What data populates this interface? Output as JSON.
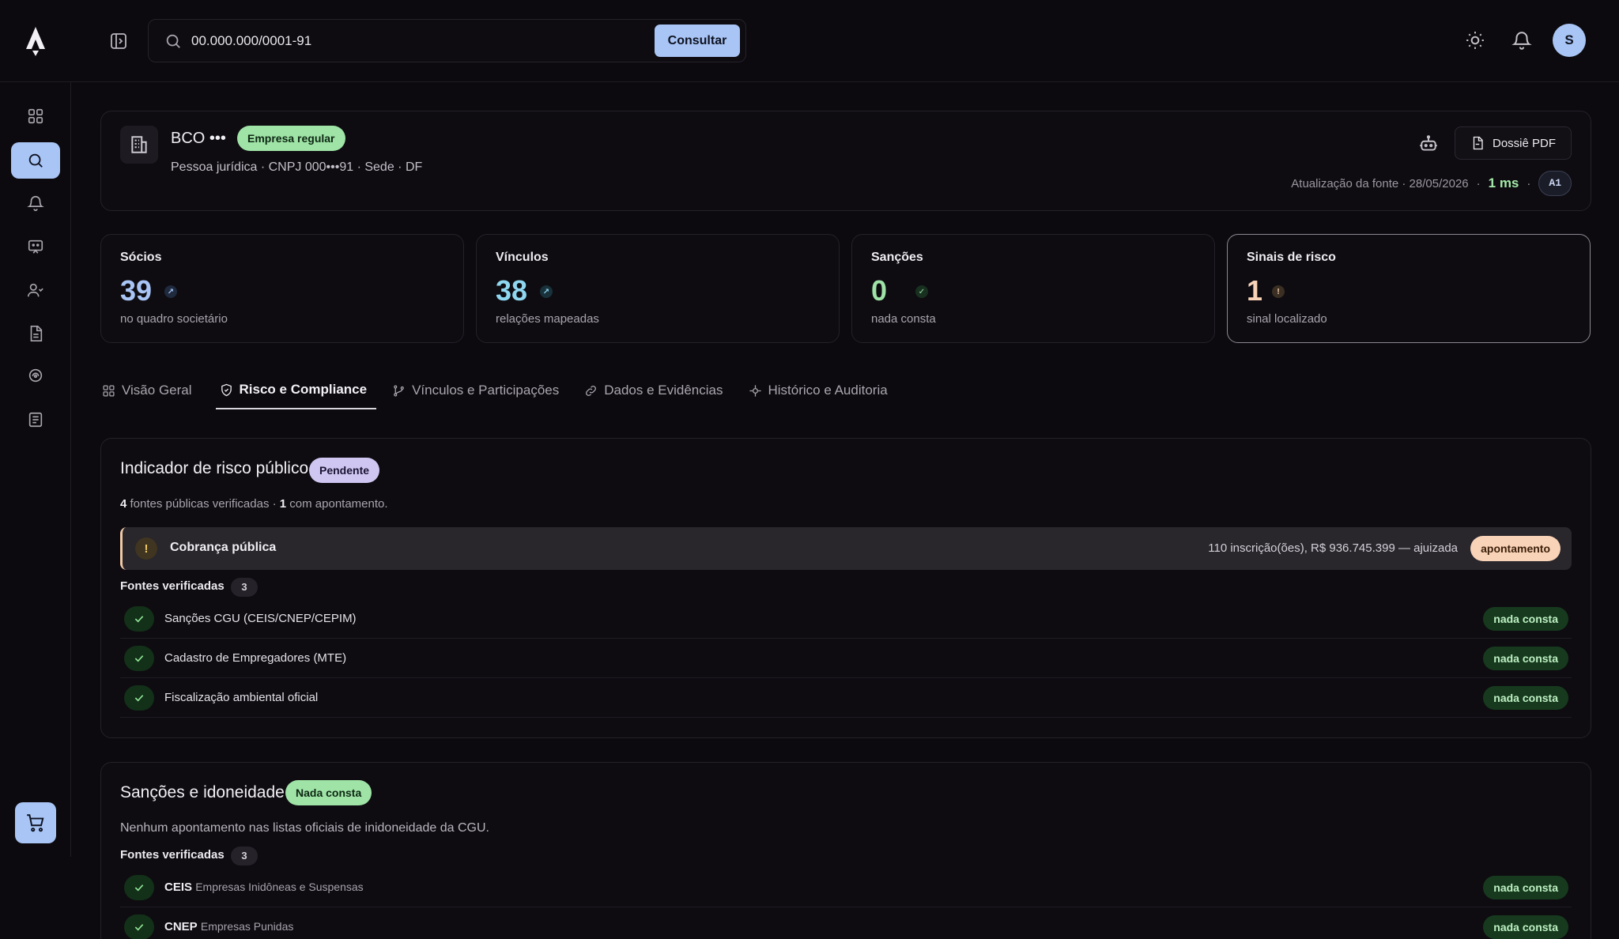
{
  "search": {
    "value": "00.000.000/0001-91",
    "button_label": "Consultar"
  },
  "user": {
    "initial": "S"
  },
  "sidebar": {
    "items": [
      {
        "icon": "grid-icon"
      },
      {
        "icon": "search-icon",
        "active": true
      },
      {
        "icon": "bell-icon"
      },
      {
        "icon": "chat-icon"
      },
      {
        "icon": "users-icon"
      },
      {
        "icon": "document-icon"
      },
      {
        "icon": "shield-icon"
      },
      {
        "icon": "list-icon"
      }
    ],
    "cart_icon": "cart-icon"
  },
  "company": {
    "name": "BCO •••",
    "status": "Empresa regular",
    "subtitle": "Pessoa jurídica · CNPJ 000•••91 · Sede · DF",
    "pdf_label": "Dossiê PDF",
    "update_label": "Atualização da fonte · 28/05/2026",
    "sep": "·",
    "latency": "1 ms",
    "level": "A1"
  },
  "stats": [
    {
      "label": "Sócios",
      "value": "39",
      "sub": "no quadro societário",
      "mark": "arrow-up-right-icon",
      "color": "#a9c5f5"
    },
    {
      "label": "Vínculos",
      "value": "38",
      "sub": "relações mapeadas",
      "mark": "arrow-up-right-icon",
      "color": "#8fd7f0"
    },
    {
      "label": "Sanções",
      "value": "0",
      "sub": "nada consta",
      "mark": "check-circle-icon",
      "color": "#9fe3a6"
    },
    {
      "label": "Sinais de risco",
      "value": "1",
      "sub": "sinal localizado",
      "mark": "alert-circle-icon",
      "color": "#f9d3b7"
    }
  ],
  "tabs": [
    {
      "label": "Visão Geral",
      "icon": "grid-icon"
    },
    {
      "label": "Risco e Compliance",
      "icon": "shield-icon",
      "active": true
    },
    {
      "label": "Vínculos e Participações",
      "icon": "branch-icon"
    },
    {
      "label": "Dados e Evidências",
      "icon": "link-icon"
    },
    {
      "label": "Histórico e Auditoria",
      "icon": "target-icon"
    }
  ],
  "risk": {
    "title": "Indicador de risco público",
    "badge": "Pendente",
    "summary_count": "4",
    "summary_text": " fontes públicas verificadas · ",
    "summary_count2": "1",
    "summary_text2": " com apontamento.",
    "alert": {
      "icon_text": "!",
      "title": "Cobrança pública",
      "detail": "110 inscrição(ões), R$ 936.745.399 — ajuizada",
      "badge": "apontamento"
    },
    "fontes_label": "Fontes verificadas",
    "fontes_count": "3",
    "sources": [
      {
        "name": "Sanções CGU (CEIS/CNEP/CEPIM)",
        "status": "nada consta"
      },
      {
        "name": "Cadastro de Empregadores (MTE)",
        "status": "nada consta"
      },
      {
        "name": "Fiscalização ambiental oficial",
        "status": "nada consta"
      }
    ]
  },
  "sanctions": {
    "title": "Sanções e idoneidade",
    "badge": "Nada consta",
    "description": "Nenhum apontamento nas listas oficiais de inidoneidade da CGU.",
    "fontes_label": "Fontes verificadas",
    "fontes_count": "3",
    "sources": [
      {
        "code": "CEIS",
        "desc": "Empresas Inidôneas e Suspensas",
        "status": "nada consta"
      },
      {
        "code": "CNEP",
        "desc": "Empresas Punidas",
        "status": "nada consta"
      }
    ]
  }
}
